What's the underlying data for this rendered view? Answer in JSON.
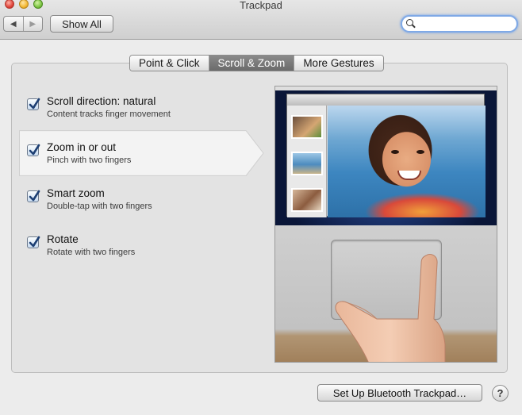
{
  "window": {
    "title": "Trackpad",
    "controls": [
      "close",
      "minimize",
      "zoom"
    ]
  },
  "toolbar": {
    "back_icon": "◀",
    "forward_icon": "▶",
    "show_all_label": "Show All",
    "search": {
      "value": "",
      "placeholder": ""
    }
  },
  "tabs": [
    {
      "label": "Point & Click",
      "active": false
    },
    {
      "label": "Scroll & Zoom",
      "active": true
    },
    {
      "label": "More Gestures",
      "active": false
    }
  ],
  "options": [
    {
      "title": "Scroll direction: natural",
      "subtitle": "Content tracks finger movement",
      "checked": true,
      "selected": false
    },
    {
      "title": "Zoom in or out",
      "subtitle": "Pinch with two fingers",
      "checked": true,
      "selected": true
    },
    {
      "title": "Smart zoom",
      "subtitle": "Double-tap with two fingers",
      "checked": true,
      "selected": false
    },
    {
      "title": "Rotate",
      "subtitle": "Rotate with two fingers",
      "checked": true,
      "selected": false
    }
  ],
  "footer": {
    "bluetooth_label": "Set Up Bluetooth Trackpad…",
    "help_label": "?"
  },
  "colors": {
    "accent": "#7fa9e6",
    "active_tab": "#7a7a7a",
    "checkmark": "#1d3f73"
  }
}
